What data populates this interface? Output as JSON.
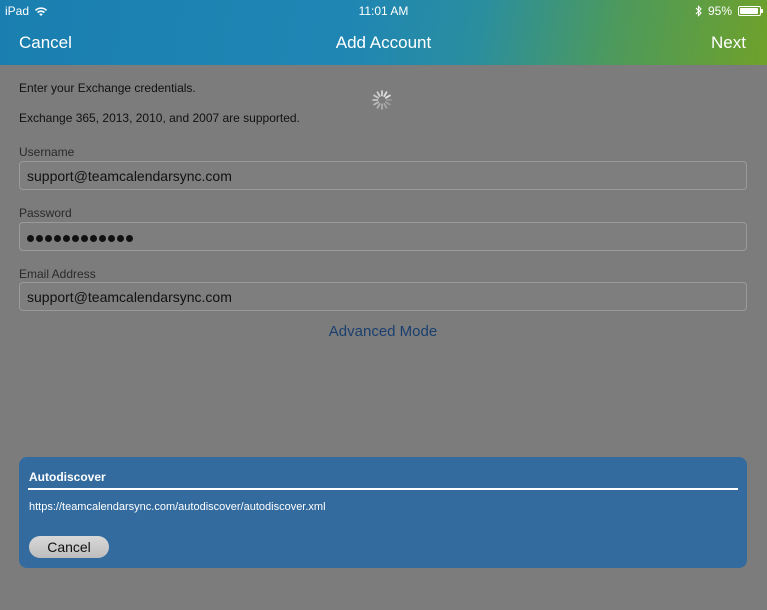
{
  "status": {
    "device": "iPad",
    "time": "11:01 AM",
    "battery_level": "95%",
    "battery_fraction": 0.95
  },
  "nav": {
    "cancel": "Cancel",
    "title": "Add Account",
    "next": "Next"
  },
  "intro": {
    "line1": "Enter your Exchange credentials.",
    "line2": "Exchange 365, 2013, 2010, and 2007 are supported."
  },
  "form": {
    "username_label": "Username",
    "username_value": "support@teamcalendarsync.com",
    "password_label": "Password",
    "password_length": 12,
    "email_label": "Email Address",
    "email_value": "support@teamcalendarsync.com"
  },
  "advanced_mode": "Advanced Mode",
  "dialog": {
    "title": "Autodiscover",
    "url": "https://teamcalendarsync.com/autodiscover/autodiscover.xml",
    "cancel": "Cancel"
  },
  "colors": {
    "accent": "#336b9f",
    "link": "#1a3f6f",
    "header_start": "#1a7fb0",
    "header_end": "#6fa12a"
  }
}
